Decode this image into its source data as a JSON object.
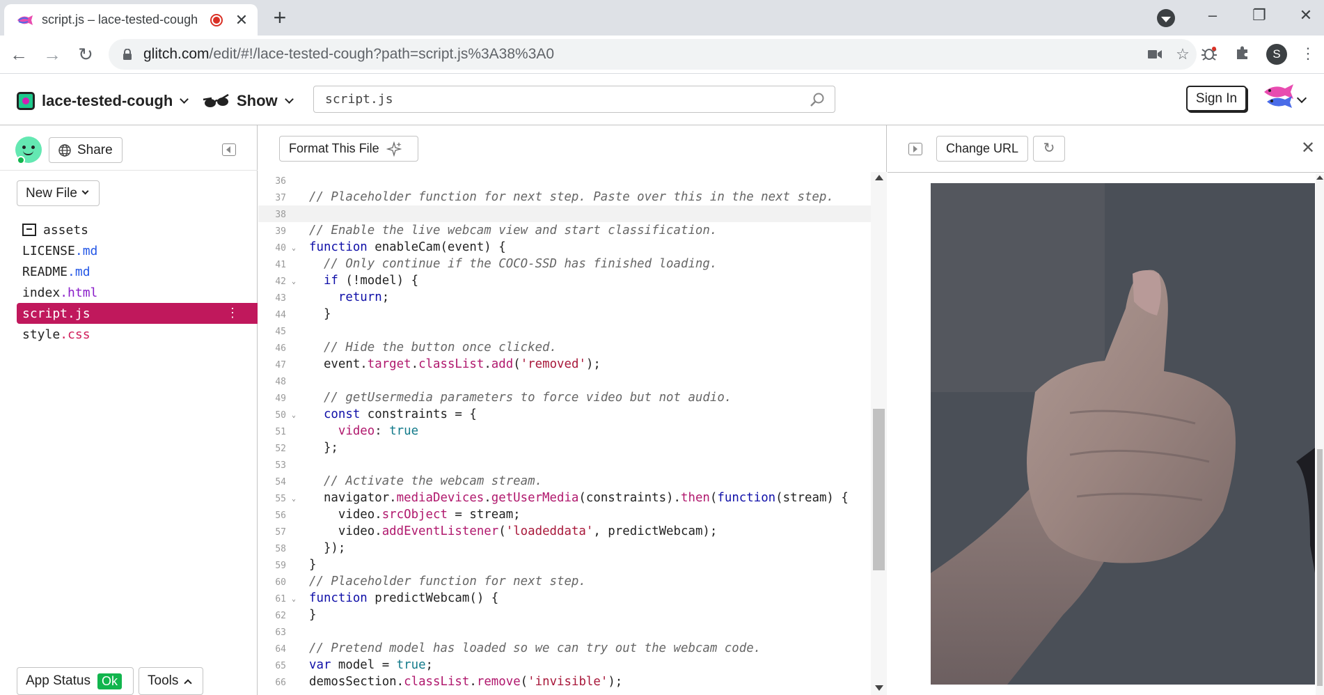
{
  "browser": {
    "tab_title": "script.js – lace-tested-cough",
    "new_tab_symbol": "+",
    "url_host": "glitch.com",
    "url_path": "/edit/#!/lace-tested-cough?path=script.js%3A38%3A0",
    "profile_initial": "S"
  },
  "header": {
    "project_name": "lace-tested-cough",
    "show_label": "Show",
    "search_value": "script.js",
    "sign_in_label": "Sign In"
  },
  "sidebar": {
    "share_label": "Share",
    "new_file_label": "New File",
    "files": [
      {
        "name": "assets",
        "ext": ""
      },
      {
        "name": "LICENSE",
        "ext": ".md"
      },
      {
        "name": "README",
        "ext": ".md"
      },
      {
        "name": "index",
        "ext": ".html"
      },
      {
        "name": "script",
        "ext": ".js"
      },
      {
        "name": "style",
        "ext": ".css"
      }
    ],
    "active_file": "script.js",
    "app_status_label": "App Status",
    "app_status_value": "Ok",
    "tools_label": "Tools"
  },
  "editor": {
    "format_label": "Format This File",
    "active_line": 38,
    "line_numbers": [
      "36",
      "37",
      "38",
      "39",
      "40",
      "41",
      "42",
      "43",
      "44",
      "45",
      "46",
      "47",
      "48",
      "49",
      "50",
      "51",
      "52",
      "53",
      "54",
      "55",
      "56",
      "57",
      "58",
      "59",
      "60",
      "61",
      "62",
      "63",
      "64",
      "65",
      "66"
    ],
    "lines": [
      "",
      "// Placeholder function for next step. Paste over this in the next step.",
      "",
      "// Enable the live webcam view and start classification.",
      "function enableCam(event) {",
      "  // Only continue if the COCO-SSD has finished loading.",
      "  if (!model) {",
      "    return;",
      "  }",
      "",
      "  // Hide the button once clicked.",
      "  event.target.classList.add('removed');",
      "",
      "  // getUsermedia parameters to force video but not audio.",
      "  const constraints = {",
      "    video: true",
      "  };",
      "",
      "  // Activate the webcam stream.",
      "  navigator.mediaDevices.getUserMedia(constraints).then(function(stream) {",
      "    video.srcObject = stream;",
      "    video.addEventListener('loadeddata', predictWebcam);",
      "  });",
      "}",
      "// Placeholder function for next step.",
      "function predictWebcam() {",
      "}",
      "",
      "// Pretend model has loaded so we can try out the webcam code.",
      "var model = true;",
      "demosSection.classList.remove('invisible');"
    ]
  },
  "preview": {
    "change_url_label": "Change URL"
  },
  "colors": {
    "accent_pink": "#c0185c",
    "status_green": "#11b54d",
    "keyword_blue": "#0f0fa8"
  }
}
